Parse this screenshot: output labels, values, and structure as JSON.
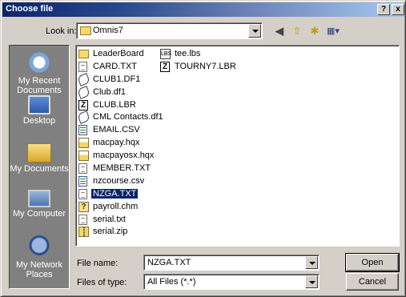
{
  "window": {
    "title": "Choose file",
    "help_glyph": "?",
    "close_glyph": "x"
  },
  "lookin": {
    "label": "Look in:",
    "value": "Omnis7"
  },
  "toolbar": {
    "back_icon": "back-arrow-icon",
    "up_icon": "up-folder-icon",
    "newfolder_icon": "new-folder-icon",
    "views_icon": "views-menu-icon"
  },
  "places": [
    {
      "label": "My Recent Documents",
      "icon": "recent-documents-icon"
    },
    {
      "label": "Desktop",
      "icon": "desktop-icon"
    },
    {
      "label": "My Documents",
      "icon": "my-documents-icon"
    },
    {
      "label": "My Computer",
      "icon": "my-computer-icon"
    },
    {
      "label": "My Network Places",
      "icon": "network-places-icon"
    }
  ],
  "files": {
    "column1": [
      {
        "name": "LeaderBoard",
        "type": "folder"
      },
      {
        "name": "CARD.TXT",
        "type": "text"
      },
      {
        "name": "CLUB1.DF1",
        "type": "df1"
      },
      {
        "name": "Club.df1",
        "type": "df1"
      },
      {
        "name": "CLUB.LBR",
        "type": "lbr"
      },
      {
        "name": "CML Contacts.df1",
        "type": "df1"
      },
      {
        "name": "EMAIL.CSV",
        "type": "csv"
      },
      {
        "name": "macpay.hqx",
        "type": "hqx"
      },
      {
        "name": "macpayosx.hqx",
        "type": "hqx"
      },
      {
        "name": "MEMBER.TXT",
        "type": "text"
      },
      {
        "name": "nzcourse.csv",
        "type": "csv"
      },
      {
        "name": "NZGA.TXT",
        "type": "text",
        "selected": true
      },
      {
        "name": "payroll.chm",
        "type": "chm"
      },
      {
        "name": "serial.txt",
        "type": "text"
      },
      {
        "name": "serial.zip",
        "type": "zip"
      }
    ],
    "column2": [
      {
        "name": "tee.lbs",
        "type": "lbs"
      },
      {
        "name": "TOURNY7.LBR",
        "type": "lbr"
      }
    ]
  },
  "filename": {
    "label": "File name:",
    "value": "NZGA.TXT"
  },
  "filetype": {
    "label": "Files of type:",
    "value": "All Files (*.*)"
  },
  "buttons": {
    "open": "Open",
    "cancel": "Cancel"
  }
}
